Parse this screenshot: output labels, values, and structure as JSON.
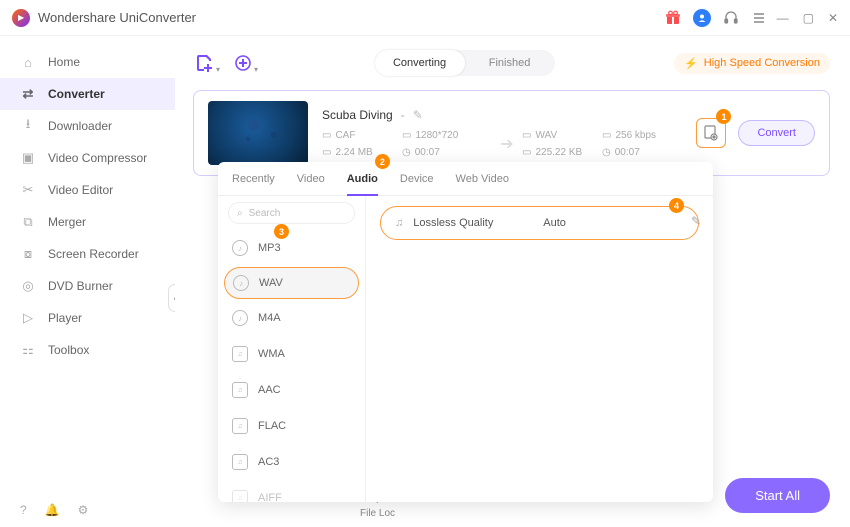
{
  "app": {
    "title": "Wondershare UniConverter"
  },
  "titlebar": {
    "gift_icon": "gift-icon",
    "user_icon": "user-icon",
    "headset_icon": "headset-icon",
    "menu_icon": "menu-icon"
  },
  "sidebar": {
    "items": [
      {
        "label": "Home",
        "icon": "home"
      },
      {
        "label": "Converter",
        "icon": "convert"
      },
      {
        "label": "Downloader",
        "icon": "download"
      },
      {
        "label": "Video Compressor",
        "icon": "compress"
      },
      {
        "label": "Video Editor",
        "icon": "scissors"
      },
      {
        "label": "Merger",
        "icon": "merge"
      },
      {
        "label": "Screen Recorder",
        "icon": "record"
      },
      {
        "label": "DVD Burner",
        "icon": "disc"
      },
      {
        "label": "Player",
        "icon": "play"
      },
      {
        "label": "Toolbox",
        "icon": "grid"
      }
    ]
  },
  "toolbar": {
    "tabs": {
      "converting": "Converting",
      "finished": "Finished"
    },
    "hsc": "High Speed Conversion"
  },
  "file": {
    "title": "Scuba Diving",
    "dash": "-",
    "src": {
      "fmt": "CAF",
      "res": "1280*720",
      "size": "2.24 MB",
      "dur": "00:07"
    },
    "dst": {
      "fmt": "WAV",
      "rate": "256 kbps",
      "size": "225.22 KB",
      "dur": "00:07"
    },
    "convert": "Convert"
  },
  "dropdown": {
    "tabs": [
      "Recently",
      "Video",
      "Audio",
      "Device",
      "Web Video"
    ],
    "search_placeholder": "Search",
    "formats": [
      "MP3",
      "WAV",
      "M4A",
      "WMA",
      "AAC",
      "FLAC",
      "AC3",
      "AIFF"
    ],
    "quality": {
      "label": "Lossless Quality",
      "value": "Auto"
    }
  },
  "steps": {
    "s1": "1",
    "s2": "2",
    "s3": "3",
    "s4": "4"
  },
  "footer": {
    "output": "Output",
    "fileloc": "File Loc",
    "start_all": "Start All"
  }
}
